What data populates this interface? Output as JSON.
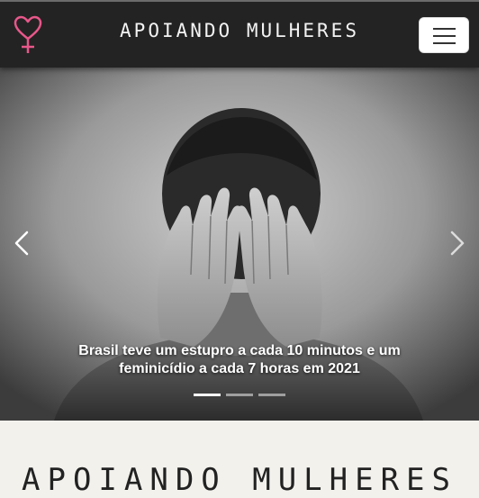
{
  "navbar": {
    "brand": "APOIANDO MULHERES",
    "logo_icon": "female-heart-symbol-icon",
    "logo_color": "#e8578a",
    "toggler_icon": "hamburger-menu-icon"
  },
  "carousel": {
    "caption": "Brasil teve um estupro a cada 10 minutos e um feminicídio a cada 7 horas em 2021",
    "prev_icon": "chevron-left-icon",
    "next_icon": "chevron-right-icon",
    "slides": 3,
    "active_slide": 1
  },
  "section": {
    "title": "APOIANDO MULHERES"
  }
}
